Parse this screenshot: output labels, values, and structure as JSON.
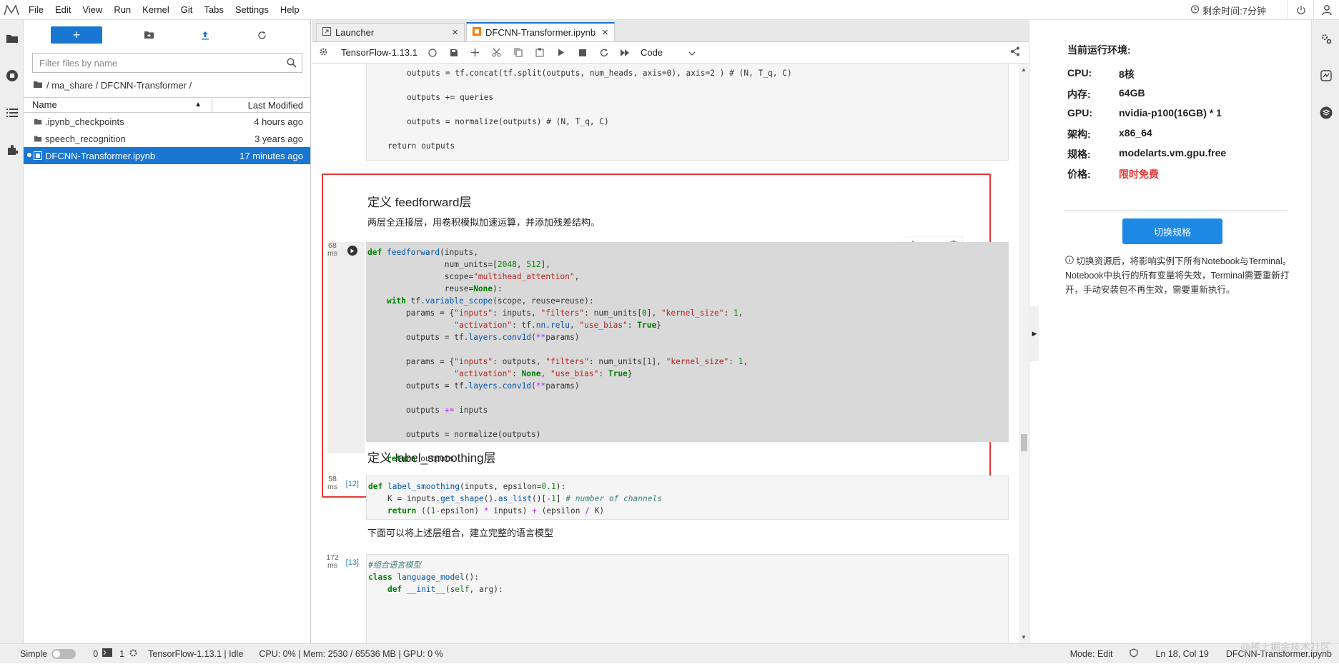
{
  "menubar": {
    "items": [
      "File",
      "Edit",
      "View",
      "Run",
      "Kernel",
      "Git",
      "Tabs",
      "Settings",
      "Help"
    ],
    "timer": "剩余时间:7分钟"
  },
  "filebrowser": {
    "new_label": "+",
    "search_placeholder": "Filter files by name",
    "breadcrumb": "/ ma_share / DFCNN-Transformer /",
    "col_name": "Name",
    "col_modified": "Last Modified",
    "files": [
      {
        "name": ".ipynb_checkpoints",
        "modified": "4 hours ago",
        "type": "folder"
      },
      {
        "name": "speech_recognition",
        "modified": "3 years ago",
        "type": "folder"
      },
      {
        "name": "DFCNN-Transformer.ipynb",
        "modified": "17 minutes ago",
        "type": "notebook",
        "selected": true
      }
    ]
  },
  "tabs": [
    {
      "label": "Launcher",
      "active": false
    },
    {
      "label": "DFCNN-Transformer.ipynb",
      "active": true
    }
  ],
  "notebook_toolbar": {
    "kernel_name": "TensorFlow-1.13.1",
    "cell_type": "Code"
  },
  "cells": {
    "top_code_lines": [
      "        outputs = tf.concat(tf.split(outputs, num_heads, axis=0), axis=2 ) # (N, T_q, C)",
      "",
      "        outputs += queries",
      "",
      "        outputs = normalize(outputs) # (N, T_q, C)",
      "",
      "    return outputs"
    ],
    "ff_heading": "定义 feedforward层",
    "ff_desc": "两层全连接层，用卷积模拟加速运算，并添加残差结构。",
    "ff_timing": [
      "68",
      "ms"
    ],
    "ls_heading": "定义 label_smoothing层",
    "ls_prompt": "[12]",
    "ls_timing": [
      "58",
      "ms"
    ],
    "combine_text": "下面可以将上述层组合，建立完整的语言模型",
    "lm_prompt": "[13]",
    "lm_timing": [
      "172",
      "ms"
    ]
  },
  "rightpanel": {
    "title": "当前运行环境:",
    "rows": [
      {
        "label": "CPU:",
        "value": "8核"
      },
      {
        "label": "内存:",
        "value": "64GB"
      },
      {
        "label": "GPU:",
        "value": "nvidia-p100(16GB) * 1"
      },
      {
        "label": "架构:",
        "value": "x86_64"
      },
      {
        "label": "规格:",
        "value": "modelarts.vm.gpu.free"
      },
      {
        "label": "价格:",
        "value": "限时免费"
      }
    ],
    "button": "切换规格",
    "note": "切换资源后，将影响实例下所有Notebook与Terminal。Notebook中执行的所有变量将失效，Terminal需要重新打开，手动安装包不再生效，需要重新执行。"
  },
  "statusbar": {
    "mode_label": "Simple",
    "terminals": "0",
    "kernels": "1",
    "kernel_status": "TensorFlow-1.13.1 | Idle",
    "resources": "CPU: 0% | Mem: 2530 / 65536 MB | GPU: 0 %",
    "edit_mode": "Mode: Edit",
    "cursor": "Ln 18, Col 19",
    "filename": "DFCNN-Transformer.ipynb"
  },
  "watermark": "@稀土掘金技术社区",
  "colors": {
    "accent": "#1976d2",
    "highlight_border": "#e53935",
    "price": "#e53935"
  }
}
